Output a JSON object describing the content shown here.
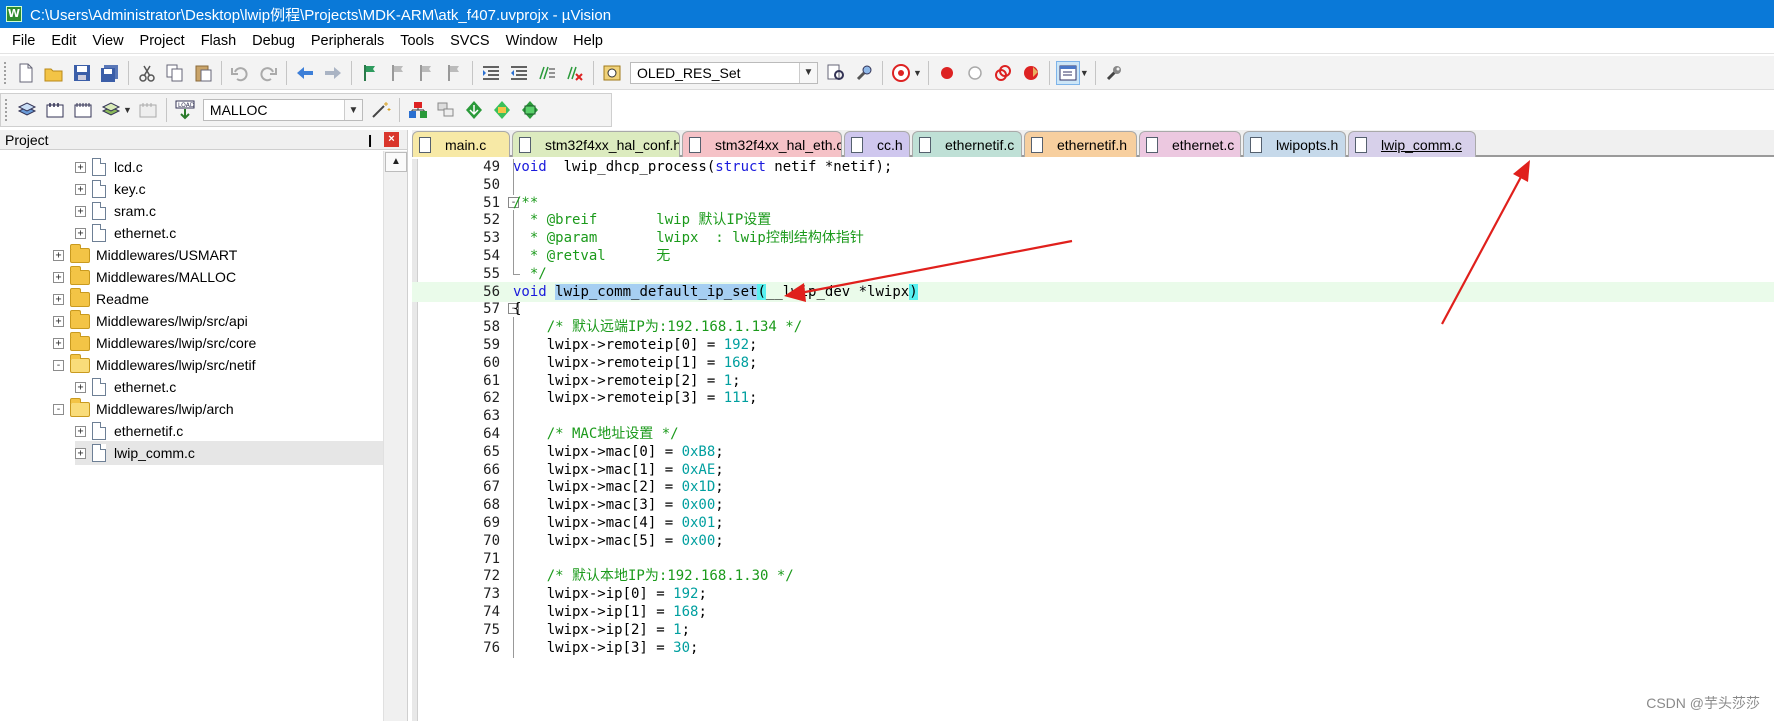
{
  "window": {
    "title": "C:\\Users\\Administrator\\Desktop\\lwip例程\\Projects\\MDK-ARM\\atk_f407.uvprojx - µVision",
    "app_icon": "W"
  },
  "menu": [
    "File",
    "Edit",
    "View",
    "Project",
    "Flash",
    "Debug",
    "Peripherals",
    "Tools",
    "SVCS",
    "Window",
    "Help"
  ],
  "toolbar1": {
    "find_combo_value": "OLED_RES_Set"
  },
  "toolbar2": {
    "target_combo_value": "MALLOC"
  },
  "project_panel": {
    "title": "Project",
    "tree": [
      {
        "label": "lcd.c",
        "kind": "file",
        "depth": 3,
        "expander": "+"
      },
      {
        "label": "key.c",
        "kind": "file",
        "depth": 3,
        "expander": "+"
      },
      {
        "label": "sram.c",
        "kind": "file",
        "depth": 3,
        "expander": "+"
      },
      {
        "label": "ethernet.c",
        "kind": "file",
        "depth": 3,
        "expander": "+"
      },
      {
        "label": "Middlewares/USMART",
        "kind": "folder",
        "depth": 2,
        "expander": "+"
      },
      {
        "label": "Middlewares/MALLOC",
        "kind": "folder",
        "depth": 2,
        "expander": "+"
      },
      {
        "label": "Readme",
        "kind": "folder",
        "depth": 2,
        "expander": "+"
      },
      {
        "label": "Middlewares/lwip/src/api",
        "kind": "folder",
        "depth": 2,
        "expander": "+"
      },
      {
        "label": "Middlewares/lwip/src/core",
        "kind": "folder",
        "depth": 2,
        "expander": "+"
      },
      {
        "label": "Middlewares/lwip/src/netif",
        "kind": "folder-open",
        "depth": 2,
        "expander": "-"
      },
      {
        "label": "ethernet.c",
        "kind": "file",
        "depth": 3,
        "expander": "+"
      },
      {
        "label": "Middlewares/lwip/arch",
        "kind": "folder-open",
        "depth": 2,
        "expander": "-"
      },
      {
        "label": "ethernetif.c",
        "kind": "file",
        "depth": 3,
        "expander": "+"
      },
      {
        "label": "lwip_comm.c",
        "kind": "file",
        "depth": 3,
        "expander": "+",
        "selected": true
      }
    ]
  },
  "tabs": [
    {
      "label": "main.c",
      "color": "#f7e9a6"
    },
    {
      "label": "stm32f4xx_hal_conf.h",
      "color": "#dcebbf"
    },
    {
      "label": "stm32f4xx_hal_eth.c",
      "color": "#f5c2c7"
    },
    {
      "label": "cc.h",
      "color": "#cfc7ee"
    },
    {
      "label": "ethernetif.c",
      "color": "#bfe0d6"
    },
    {
      "label": "ethernetif.h",
      "color": "#f7cf9f"
    },
    {
      "label": "ethernet.c",
      "color": "#ecc8e0"
    },
    {
      "label": "lwipopts.h",
      "color": "#c6d9ea"
    },
    {
      "label": "lwip_comm.c",
      "color": "#d7d0ea",
      "active": true
    }
  ],
  "code": [
    {
      "n": "49",
      "fold": "bar",
      "parts": [
        [
          "kw",
          "void"
        ],
        [
          "",
          "  lwip_dhcp_process("
        ],
        [
          "kw",
          "struct"
        ],
        [
          "",
          " netif *netif);"
        ]
      ]
    },
    {
      "n": "50",
      "fold": "bar",
      "parts": []
    },
    {
      "n": "51",
      "fold": "minus",
      "parts": [
        [
          "cm",
          "/**"
        ]
      ]
    },
    {
      "n": "52",
      "fold": "bar",
      "parts": [
        [
          "cm",
          "  * @breif       lwip 默认IP设置"
        ]
      ]
    },
    {
      "n": "53",
      "fold": "bar",
      "parts": [
        [
          "cm",
          "  * @param       lwipx  : lwip控制结构体指针"
        ]
      ]
    },
    {
      "n": "54",
      "fold": "bar",
      "parts": [
        [
          "cm",
          "  * @retval      无"
        ]
      ]
    },
    {
      "n": "55",
      "fold": "end",
      "parts": [
        [
          "cm",
          "  */"
        ]
      ]
    },
    {
      "n": "56",
      "fold": "none",
      "current": true,
      "parts": [
        [
          "kw",
          "void"
        ],
        [
          "",
          " "
        ],
        [
          "sel",
          "lwip_comm_default_ip_set"
        ],
        [
          "brace",
          "("
        ],
        [
          "",
          "__lwip_dev *lwipx"
        ],
        [
          "brace",
          ")"
        ]
      ]
    },
    {
      "n": "57",
      "fold": "minus",
      "parts": [
        [
          "",
          "{"
        ]
      ]
    },
    {
      "n": "58",
      "fold": "bar",
      "parts": [
        [
          "cm",
          "    /* 默认远端IP为:192.168.1.134 */"
        ]
      ]
    },
    {
      "n": "59",
      "fold": "bar",
      "parts": [
        [
          "",
          "    lwipx->remoteip[0] = "
        ],
        [
          "num",
          "192"
        ],
        [
          "",
          ";"
        ]
      ]
    },
    {
      "n": "60",
      "fold": "bar",
      "parts": [
        [
          "",
          "    lwipx->remoteip[1] = "
        ],
        [
          "num",
          "168"
        ],
        [
          "",
          ";"
        ]
      ]
    },
    {
      "n": "61",
      "fold": "bar",
      "parts": [
        [
          "",
          "    lwipx->remoteip[2] = "
        ],
        [
          "num",
          "1"
        ],
        [
          "",
          ";"
        ]
      ]
    },
    {
      "n": "62",
      "fold": "bar",
      "parts": [
        [
          "",
          "    lwipx->remoteip[3] = "
        ],
        [
          "num",
          "111"
        ],
        [
          "",
          ";"
        ]
      ]
    },
    {
      "n": "63",
      "fold": "bar",
      "parts": []
    },
    {
      "n": "64",
      "fold": "bar",
      "parts": [
        [
          "cm",
          "    /* MAC地址设置 */"
        ]
      ]
    },
    {
      "n": "65",
      "fold": "bar",
      "parts": [
        [
          "",
          "    lwipx->mac[0] = "
        ],
        [
          "num",
          "0xB8"
        ],
        [
          "",
          ";"
        ]
      ]
    },
    {
      "n": "66",
      "fold": "bar",
      "parts": [
        [
          "",
          "    lwipx->mac[1] = "
        ],
        [
          "num",
          "0xAE"
        ],
        [
          "",
          ";"
        ]
      ]
    },
    {
      "n": "67",
      "fold": "bar",
      "parts": [
        [
          "",
          "    lwipx->mac[2] = "
        ],
        [
          "num",
          "0x1D"
        ],
        [
          "",
          ";"
        ]
      ]
    },
    {
      "n": "68",
      "fold": "bar",
      "parts": [
        [
          "",
          "    lwipx->mac[3] = "
        ],
        [
          "num",
          "0x00"
        ],
        [
          "",
          ";"
        ]
      ]
    },
    {
      "n": "69",
      "fold": "bar",
      "parts": [
        [
          "",
          "    lwipx->mac[4] = "
        ],
        [
          "num",
          "0x01"
        ],
        [
          "",
          ";"
        ]
      ]
    },
    {
      "n": "70",
      "fold": "bar",
      "parts": [
        [
          "",
          "    lwipx->mac[5] = "
        ],
        [
          "num",
          "0x00"
        ],
        [
          "",
          ";"
        ]
      ]
    },
    {
      "n": "71",
      "fold": "bar",
      "parts": []
    },
    {
      "n": "72",
      "fold": "bar",
      "parts": [
        [
          "cm",
          "    /* 默认本地IP为:192.168.1.30 */"
        ]
      ]
    },
    {
      "n": "73",
      "fold": "bar",
      "parts": [
        [
          "",
          "    lwipx->ip[0] = "
        ],
        [
          "num",
          "192"
        ],
        [
          "",
          ";"
        ]
      ]
    },
    {
      "n": "74",
      "fold": "bar",
      "parts": [
        [
          "",
          "    lwipx->ip[1] = "
        ],
        [
          "num",
          "168"
        ],
        [
          "",
          ";"
        ]
      ]
    },
    {
      "n": "75",
      "fold": "bar",
      "parts": [
        [
          "",
          "    lwipx->ip[2] = "
        ],
        [
          "num",
          "1"
        ],
        [
          "",
          ";"
        ]
      ]
    },
    {
      "n": "76",
      "fold": "bar",
      "parts": [
        [
          "",
          "    lwipx->ip[3] = "
        ],
        [
          "num",
          "30"
        ],
        [
          "",
          ";"
        ]
      ]
    }
  ],
  "colors": {
    "title_bar": "#0a79d8",
    "annotation_arrow": "#e0201c"
  },
  "watermark": "CSDN @芋头莎莎"
}
